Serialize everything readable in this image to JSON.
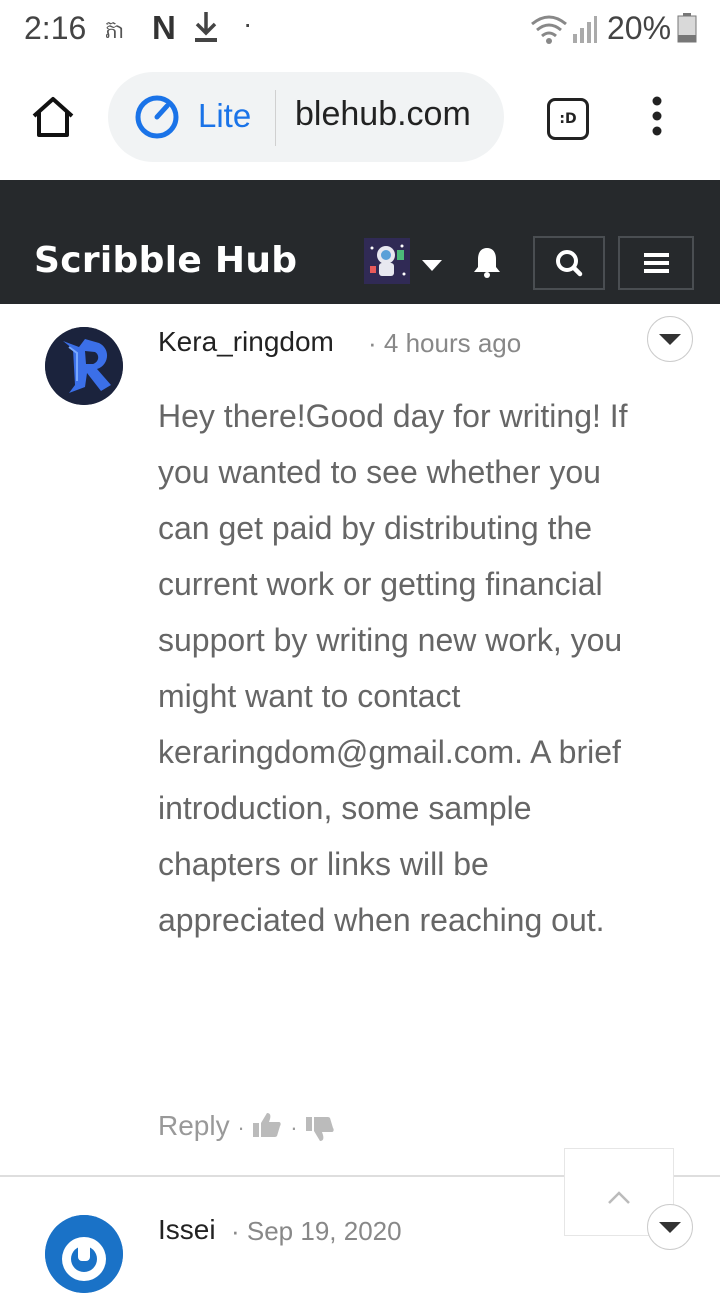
{
  "status_bar": {
    "time": "2:16",
    "carrier_glyph": "ភ៊ា",
    "netflix_letter": "N",
    "dot": "·",
    "battery": "20%"
  },
  "browser": {
    "lite_label": "Lite",
    "url": "blehub.com",
    "tabs_label": ":D",
    "icons": [
      "home-icon",
      "speed-gauge-icon",
      "tab-switcher-icon",
      "more-vert-icon"
    ]
  },
  "site": {
    "title": "Scribble Hub",
    "icons": [
      "bell-icon",
      "search-icon",
      "hamburger-icon"
    ]
  },
  "comments": [
    {
      "author": "Kera_ringdom",
      "time": "· 4 hours ago",
      "body": "Hey there!Good day for writing! If you wanted to see whether you can get paid by distributing the current work or getting financial support by writing new work, you might want to contact keraringdom@gmail.com. A brief introduction, some sample chapters or links will be appreciated when reaching out.",
      "reply_label": "Reply",
      "sep": "·"
    },
    {
      "author": "Issei",
      "time": "· Sep 19, 2020"
    }
  ],
  "colors": {
    "site_header_bg": "#26292c",
    "browser_accent": "#1a73e8",
    "comment_text": "#666666"
  }
}
